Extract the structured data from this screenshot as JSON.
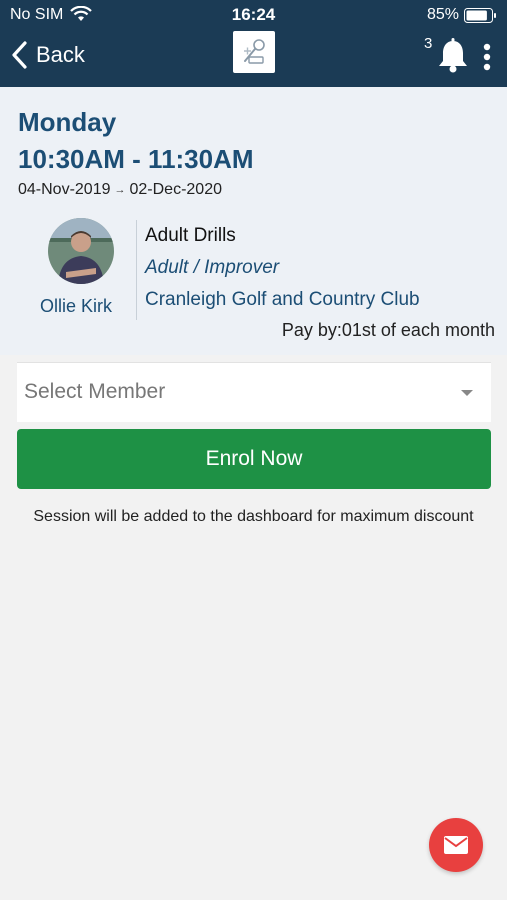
{
  "status_bar": {
    "carrier": "No SIM",
    "time": "16:24",
    "battery": "85%",
    "battery_level": 0.85,
    "wifi_icon": "wifi-icon",
    "battery_icon": "battery-icon"
  },
  "nav": {
    "back_label": "Back",
    "back_icon": "chevron-left-icon",
    "logo_icon": "app-logo",
    "notification_count": "3",
    "bell_icon": "bell-icon",
    "more_icon": "more-vertical-icon"
  },
  "session": {
    "day": "Monday",
    "time_range": "10:30AM - 11:30AM",
    "start_date": "04-Nov-2019",
    "date_arrow": "→",
    "end_date": "02-Dec-2020",
    "coach_name": "Ollie Kirk",
    "class_name": "Adult Drills",
    "level": "Adult / Improver",
    "venue": "Cranleigh Golf and Country Club",
    "pay_by": "Pay by:01st of each month"
  },
  "member_select": {
    "placeholder": "Select Member"
  },
  "actions": {
    "enrol_label": "Enrol Now",
    "note": "Session will be added to the dashboard for maximum discount"
  },
  "fab": {
    "icon": "mail-icon"
  },
  "colors": {
    "header_bg": "#1b3b55",
    "accent_blue": "#1c4e75",
    "enrol_green": "#1e9145",
    "fab_red": "#e8403f",
    "panel_bg": "#edf1f6"
  }
}
